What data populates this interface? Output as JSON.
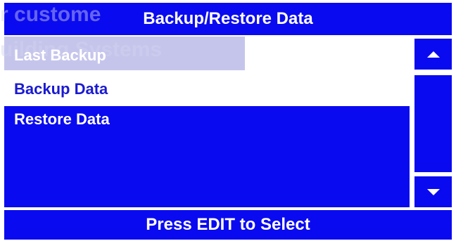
{
  "title": "Backup/Restore Data",
  "ghost_text": [
    "r custome",
    "uilding Systems"
  ],
  "menu": {
    "items": [
      {
        "label": "Last Backup",
        "state": "normal"
      },
      {
        "label": "Backup Data",
        "state": "selected"
      },
      {
        "label": "Restore Data",
        "state": "normal"
      }
    ]
  },
  "scrollbar": {
    "up_icon": "triangle-up",
    "down_icon": "triangle-down"
  },
  "footer": "Press EDIT to Select",
  "colors": {
    "panel_blue": "#0a0af0",
    "selected_bg": "#ffffff",
    "selected_text": "#1a1ad0",
    "text": "#ffffff"
  }
}
